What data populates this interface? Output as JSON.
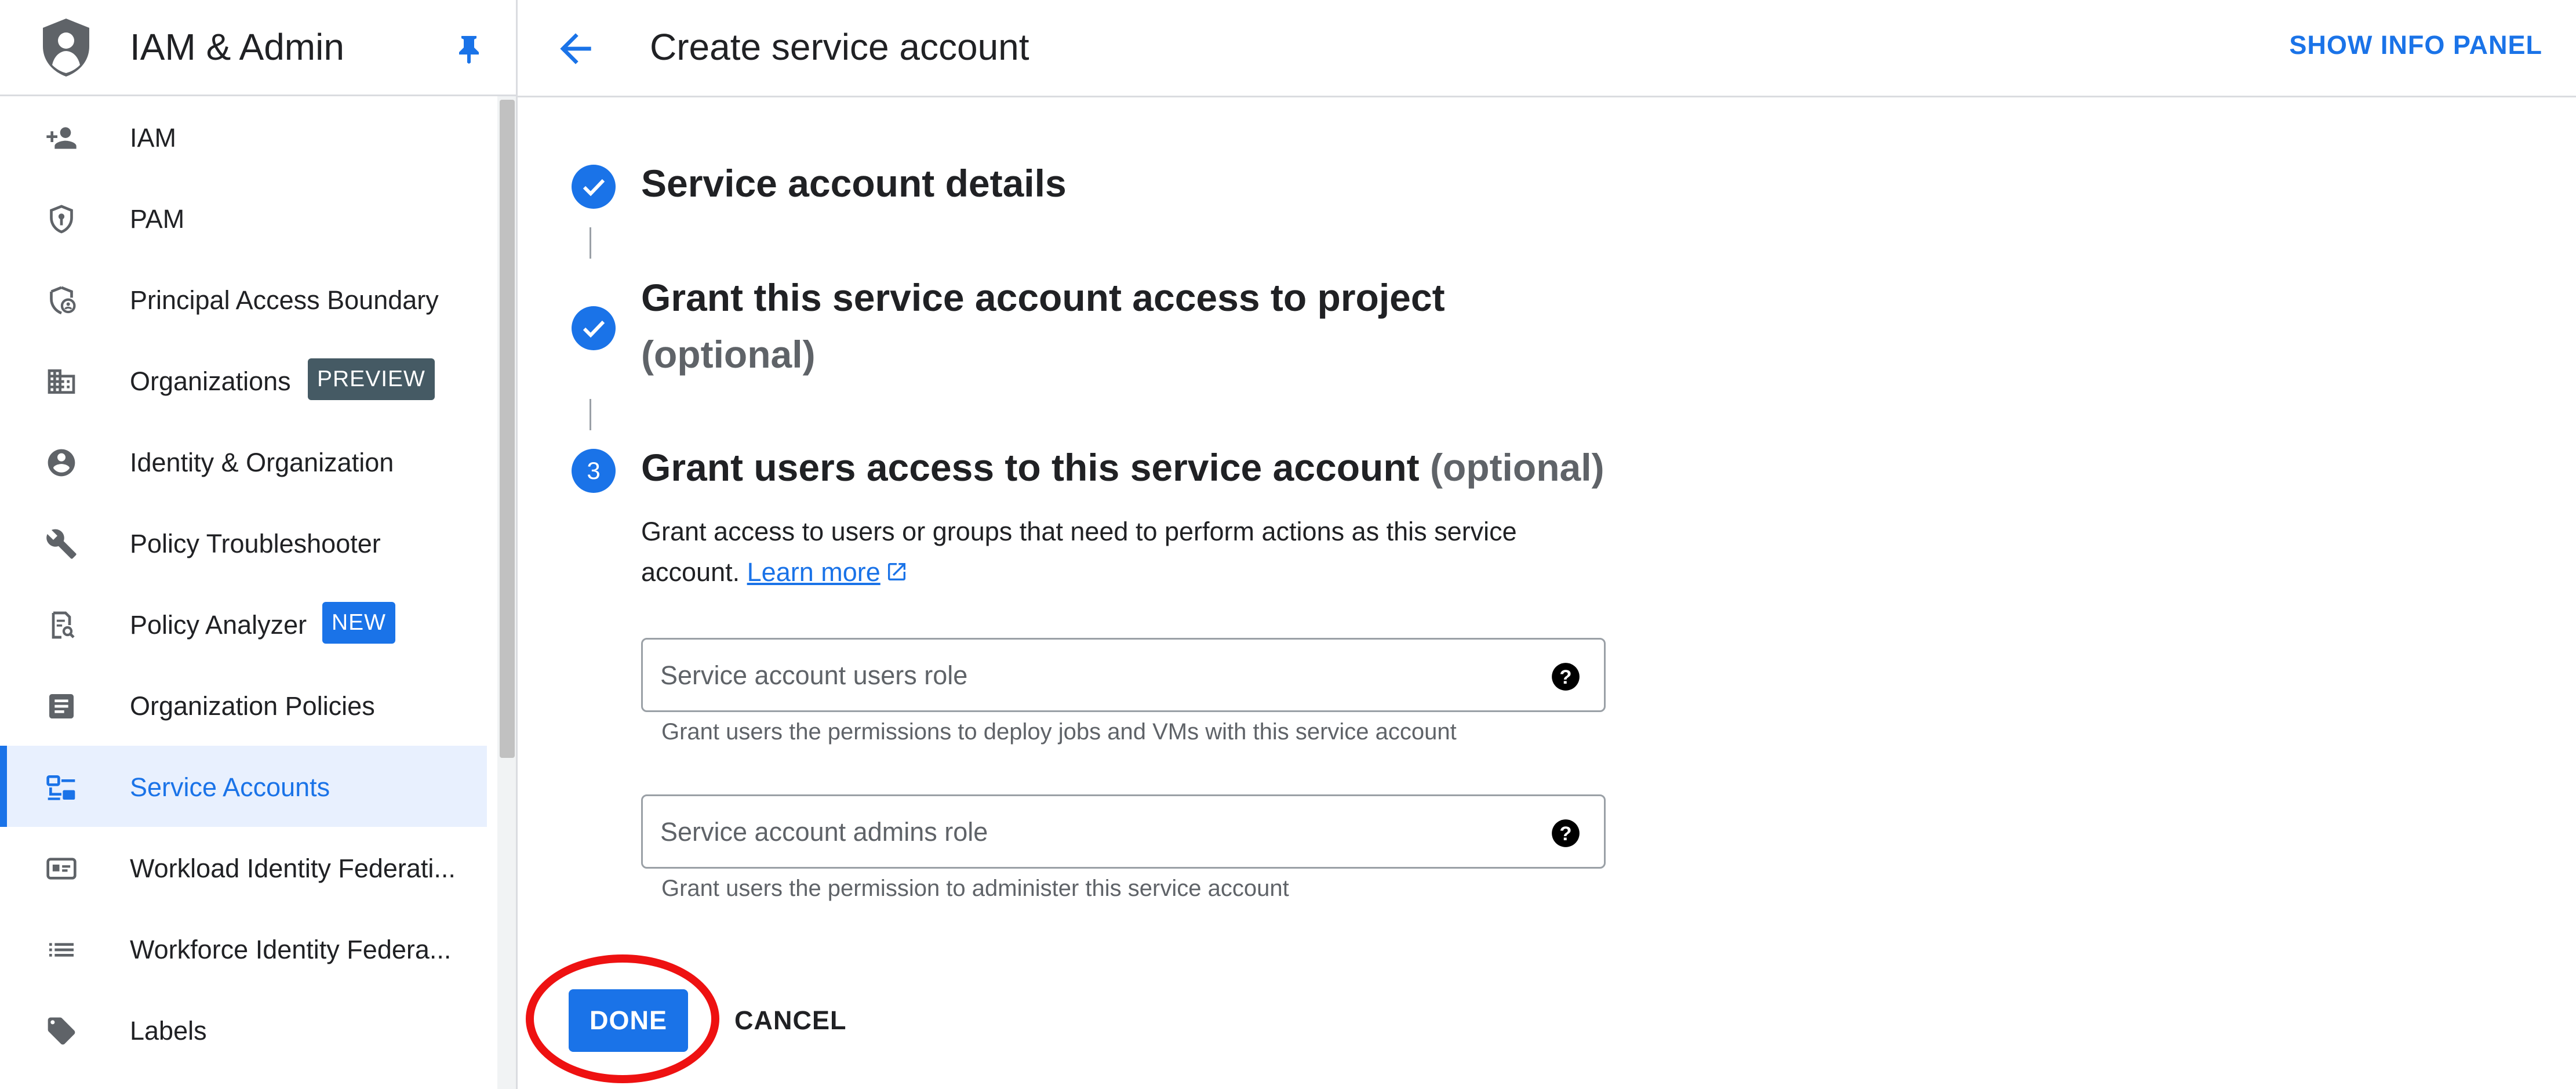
{
  "sidebar": {
    "app_title": "IAM & Admin",
    "icons": {
      "logo": "iam-shield-logo",
      "pin": "pin-icon"
    },
    "items": [
      {
        "label": "IAM",
        "icon": "person-add-icon"
      },
      {
        "label": "PAM",
        "icon": "shield-key-icon"
      },
      {
        "label": "Principal Access Boundary",
        "icon": "shield-person-icon"
      },
      {
        "label": "Organizations",
        "icon": "building-icon",
        "badge": "PREVIEW"
      },
      {
        "label": "Identity & Organization",
        "icon": "account-circle-icon"
      },
      {
        "label": "Policy Troubleshooter",
        "icon": "wrench-icon"
      },
      {
        "label": "Policy Analyzer",
        "icon": "document-search-icon",
        "badge": "NEW"
      },
      {
        "label": "Organization Policies",
        "icon": "list-document-icon"
      },
      {
        "label": "Service Accounts",
        "icon": "service-account-icon",
        "active": true
      },
      {
        "label": "Workload Identity Federati...",
        "icon": "id-card-icon"
      },
      {
        "label": "Workforce Identity Federa...",
        "icon": "list-icon"
      },
      {
        "label": "Labels",
        "icon": "tag-icon"
      }
    ]
  },
  "header": {
    "title": "Create service account",
    "info_panel_label": "SHOW INFO PANEL",
    "back_icon": "arrow-back-icon"
  },
  "steps": [
    {
      "title": "Service account details",
      "status": "complete"
    },
    {
      "title_line1": "Grant this service account access to project",
      "optional": "(optional)",
      "status": "complete"
    },
    {
      "number": "3",
      "title": "Grant users access to this service account",
      "optional": "(optional)",
      "status": "active",
      "description": "Grant access to users or groups that need to perform actions as this service account.",
      "learn_more": "Learn more",
      "fields": [
        {
          "placeholder": "Service account users role",
          "value": "",
          "hint": "Grant users the permissions to deploy jobs and VMs with this service account"
        },
        {
          "placeholder": "Service account admins role",
          "value": "",
          "hint": "Grant users the permission to administer this service account"
        }
      ]
    }
  ],
  "actions": {
    "done_label": "DONE",
    "cancel_label": "CANCEL"
  },
  "colors": {
    "accent": "#1a73e8",
    "badge_preview": "#455a64",
    "badge_new": "#1a73e8",
    "annotation_circle": "#ee1111"
  }
}
